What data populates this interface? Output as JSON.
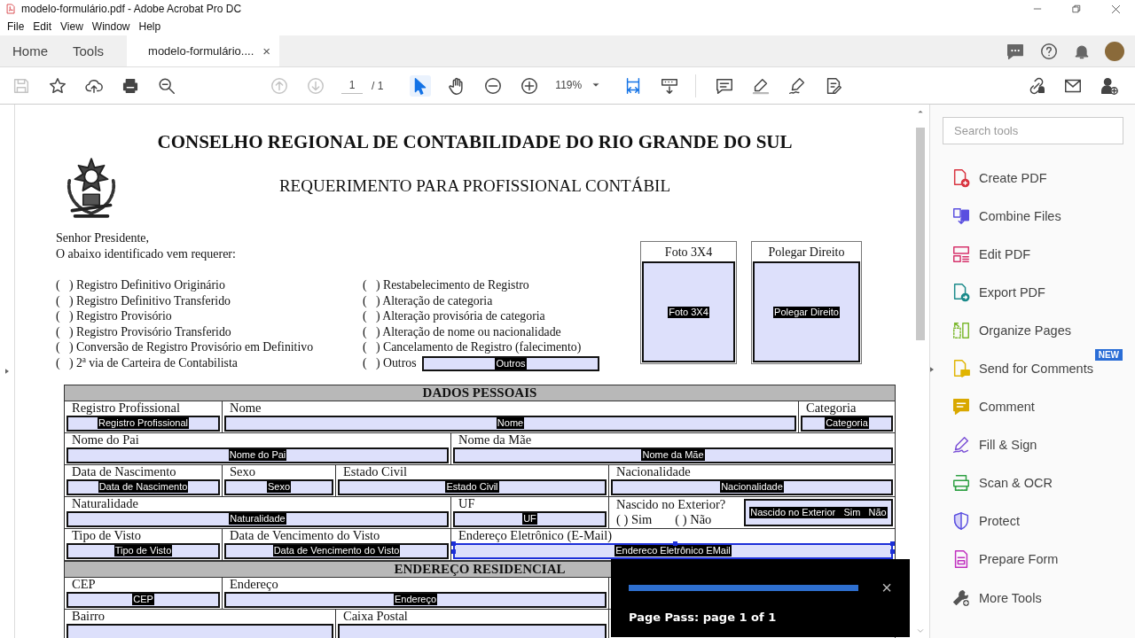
{
  "window": {
    "title": "modelo-formulário.pdf - Adobe Acrobat Pro DC"
  },
  "menu": [
    "File",
    "Edit",
    "View",
    "Window",
    "Help"
  ],
  "tabs": [
    {
      "label": "Home",
      "selected": false
    },
    {
      "label": "Tools",
      "selected": false
    },
    {
      "label": "modelo-formulário....",
      "selected": true,
      "close": "×"
    }
  ],
  "toolbar": {
    "buttons": [
      {
        "disabled": true,
        "selected": false
      },
      {
        "disabled": false,
        "selected": false
      },
      {
        "disabled": false,
        "selected": false
      },
      {
        "disabled": false,
        "selected": false
      },
      {
        "disabled": false,
        "selected": false
      },
      {
        "disabled": true,
        "selected": false
      },
      {
        "disabled": true,
        "selected": false
      },
      {
        "disabled": false,
        "selected": true
      },
      {
        "disabled": false,
        "selected": false
      },
      {
        "disabled": false,
        "selected": false
      },
      {
        "disabled": false,
        "selected": false
      },
      {
        "disabled": false,
        "selected": false
      },
      {
        "disabled": false,
        "selected": false
      },
      {
        "disabled": false,
        "selected": false
      },
      {
        "disabled": false,
        "selected": false
      },
      {
        "disabled": false,
        "selected": false
      },
      {
        "disabled": false,
        "selected": false
      },
      {
        "disabled": false,
        "selected": false
      },
      {
        "disabled": false,
        "selected": false
      },
      {
        "disabled": false,
        "selected": false
      }
    ],
    "page_number": "1",
    "page_count": "/ 1",
    "zoom": "119%"
  },
  "document": {
    "title": "CONSELHO REGIONAL DE CONTABILIDADE DO RIO GRANDE DO SUL",
    "subtitle": "REQUERIMENTO PARA PROFISSIONAL CONTÁBIL",
    "greeting": [
      "Senhor Presidente,",
      "O abaixo identificado vem requerer:"
    ],
    "options_left": [
      {
        "label": "(   ) Registro Definitivo Originário"
      },
      {
        "label": "(   ) Registro Definitivo Transferido"
      },
      {
        "label": "(   ) Registro Provisório"
      },
      {
        "label": "(   ) Registro Provisório Transferido"
      },
      {
        "label": "(   ) Conversão de Registro Provisório em Definitivo"
      },
      {
        "label": "(   ) 2ª via de Carteira de Contabilista"
      }
    ],
    "options_right": [
      {
        "label": "(   ) Restabelecimento de Registro"
      },
      {
        "label": "(   ) Alteração de categoria"
      },
      {
        "label": "(   ) Alteração provisória de categoria"
      },
      {
        "label": "(   ) Alteração de nome ou nacionalidade"
      },
      {
        "label": "(   ) Cancelamento de Registro (falecimento)"
      },
      {
        "label": "(   ) Outros",
        "field": "Outros"
      }
    ],
    "photo_boxes": [
      {
        "label": "Foto 3X4",
        "field": "Foto 3X4"
      },
      {
        "label": "Polegar Direito",
        "field": "Polegar Direito"
      }
    ],
    "sections": [
      {
        "title": "DADOS PESSOAIS",
        "rows": [
          [
            {
              "label": "Registro Profissional",
              "field": "Registro Profissional",
              "selected": false
            },
            {
              "label": "Nome",
              "field": "Nome",
              "selected": false
            },
            {
              "label": "Categoria",
              "field": "Categoria",
              "selected": false
            }
          ],
          [
            {
              "label": "Nome do Pai",
              "field": "Nome do Pai",
              "selected": false
            },
            {
              "label": "Nome da Mãe",
              "field": "Nome da Mãe",
              "selected": false
            }
          ],
          [
            {
              "label": "Data de Nascimento",
              "field": "Data de Nascimento",
              "selected": false
            },
            {
              "label": "Sexo",
              "field": "Sexo",
              "selected": false
            },
            {
              "label": "Estado Civil",
              "field": "Estado Civil",
              "selected": false
            },
            {
              "label": "Nacionalidade",
              "field": "Nacionalidade",
              "selected": false
            }
          ],
          [
            {
              "label": "Naturalidade",
              "field": "Naturalidade",
              "selected": false
            },
            {
              "label": "UF",
              "field": "UF",
              "selected": false
            },
            {
              "kind": "choice",
              "label": "Nascido no Exterior?",
              "choices": [
                "(   ) Sim",
                "(   ) Não"
              ],
              "field": "Nascido no Exterior   Sim   Não",
              "selected": false
            }
          ],
          [
            {
              "label": "Tipo de Visto",
              "field": "Tipo de Visto",
              "selected": false
            },
            {
              "label": "Data de Vencimento do Visto",
              "field": "Data de Vencimento do Visto",
              "selected": false
            },
            {
              "label": "Endereço Eletrônico (E-Mail)",
              "field": "Endereco Eletrônico EMail",
              "selected": true
            }
          ]
        ]
      },
      {
        "title": "ENDEREÇO RESIDENCIAL",
        "rows": [
          [
            {
              "label": "CEP",
              "field": "CEP",
              "selected": false
            },
            {
              "label": "Endereço",
              "field": "Endereço",
              "selected": false
            }
          ],
          [
            {
              "label": "Bairro"
            },
            {
              "label": "Caixa Postal"
            }
          ]
        ]
      }
    ]
  },
  "tools_pane": {
    "search": {
      "placeholder": "Search tools"
    },
    "tools": [
      {
        "label": "Create PDF"
      },
      {
        "label": "Combine Files"
      },
      {
        "label": "Edit PDF"
      },
      {
        "label": "Export PDF"
      },
      {
        "label": "Organize Pages"
      },
      {
        "label": "Send for Comments",
        "badge": "NEW"
      },
      {
        "label": "Comment"
      },
      {
        "label": "Fill & Sign"
      },
      {
        "label": "Scan & OCR"
      },
      {
        "label": "Protect"
      },
      {
        "label": "Prepare Form"
      },
      {
        "label": "More Tools"
      }
    ]
  },
  "toast": {
    "level": 1,
    "close": "×",
    "message": "Page Pass: page 1 of 1"
  }
}
